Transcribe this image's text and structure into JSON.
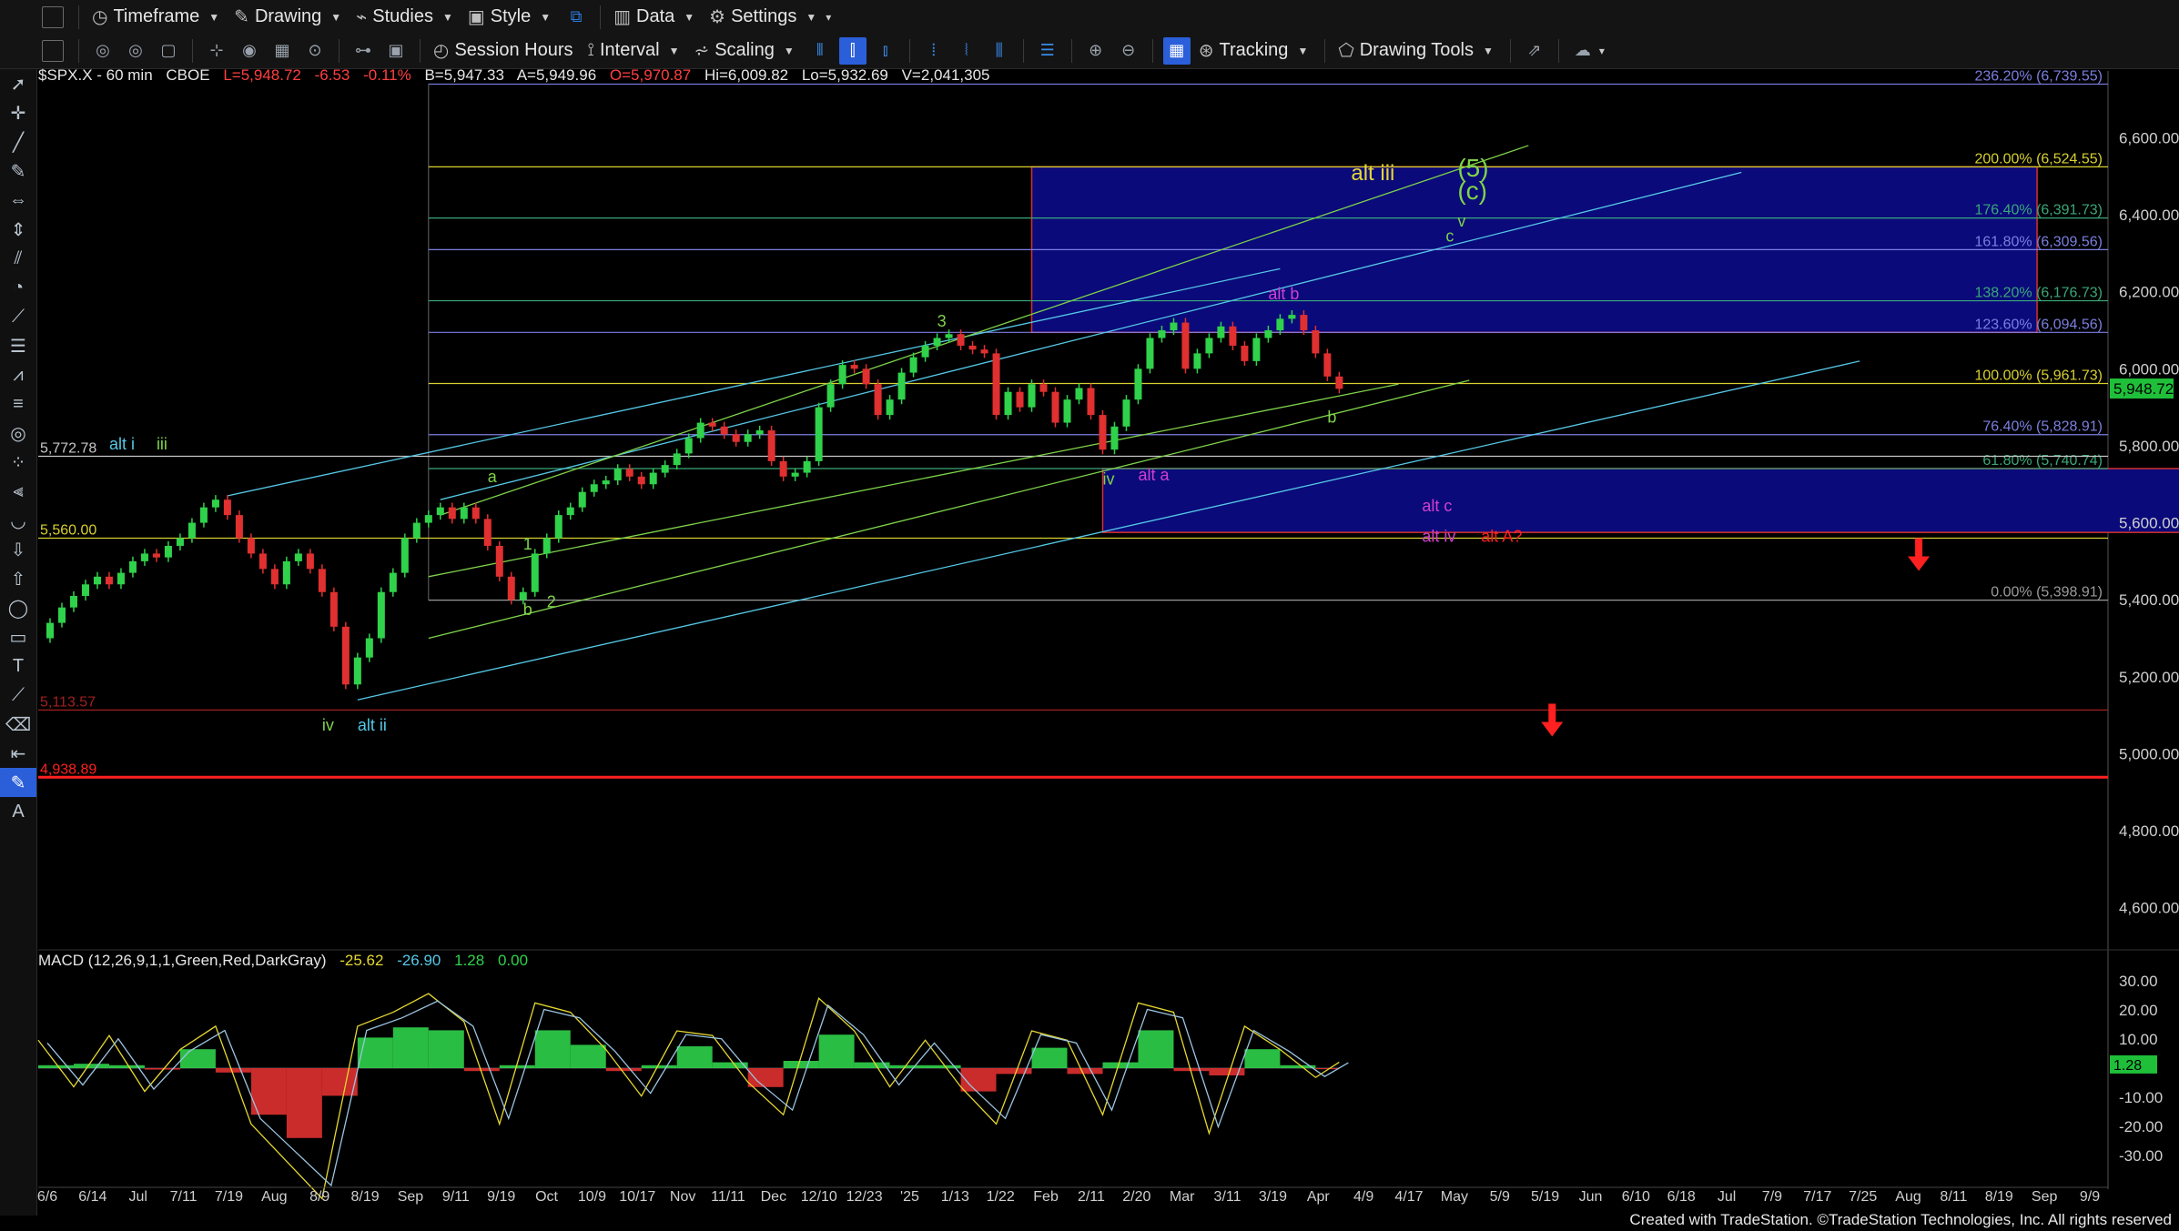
{
  "toolbar": {
    "row1": [
      {
        "label": "Timeframe",
        "icon": "clock-icon"
      },
      {
        "label": "Drawing",
        "icon": "pencil-icon"
      },
      {
        "label": "Studies",
        "icon": "studies-icon"
      },
      {
        "label": "Style",
        "icon": "style-icon"
      },
      {
        "label": "Data",
        "icon": "data-icon"
      },
      {
        "label": "Settings",
        "icon": "gear-icon"
      }
    ],
    "row2": [
      {
        "label": "Session Hours",
        "icon": "session-icon"
      },
      {
        "label": "Interval",
        "icon": "interval-icon"
      },
      {
        "label": "Scaling",
        "icon": "scaling-icon"
      },
      {
        "label": "Tracking",
        "icon": "tracking-icon"
      },
      {
        "label": "Drawing Tools",
        "icon": "drawing-tools-icon"
      }
    ]
  },
  "header": {
    "symbol": "$SPX.X - 60 min",
    "exchange": "CBOE",
    "last": "L=5,948.72",
    "change": "-6.53",
    "pct": "-0.11%",
    "bid": "B=5,947.33",
    "ask": "A=5,949.96",
    "open": "O=5,970.87",
    "high": "Hi=6,009.82",
    "low": "Lo=5,932.69",
    "volume": "V=2,041,305"
  },
  "macd_header": {
    "name": "MACD (12,26,9,1,1,Green,Red,DarkGray)",
    "v1": "-25.62",
    "v2": "-26.90",
    "v3": "1.28",
    "v4": "0.00"
  },
  "footer": "Created with TradeStation. ©TradeStation Technologies, Inc. All rights reserved",
  "colors": {
    "up": "#2fd24a",
    "down": "#e03030",
    "fib": "#8a8fd8",
    "zone": "#0a0a7a",
    "zone_border": "#d43030",
    "cyan": "#55c8e6",
    "green": "#7fd34a",
    "yellow": "#e6d830",
    "magenta": "#d040d0",
    "red": "#ff2020"
  },
  "chart_data": {
    "type": "candlestick",
    "price_axis": {
      "ticks": [
        4600,
        4800,
        5000,
        5200,
        5400,
        5600,
        5800,
        6000,
        6200,
        6400,
        6600
      ],
      "tick_labels": [
        "4,600.00",
        "4,800.00",
        "5,000.00",
        "5,200.00",
        "5,400.00",
        "5,600.00",
        "5,800.00",
        "6,000.00",
        "6,200.00",
        "6,400.00",
        "6,600.00"
      ],
      "ylim": [
        4500,
        6750
      ],
      "last_label": "5,948.72",
      "last": 5948.72
    },
    "time_axis": {
      "labels": [
        "6/6",
        "6/14",
        "Jul",
        "7/11",
        "7/19",
        "Aug",
        "8/9",
        "8/19",
        "Sep",
        "9/11",
        "9/19",
        "Oct",
        "10/9",
        "10/17",
        "Nov",
        "11/11",
        "Dec",
        "12/10",
        "12/23",
        "'25",
        "1/13",
        "1/22",
        "Feb",
        "2/11",
        "2/20",
        "Mar",
        "3/11",
        "3/19",
        "Apr",
        "4/9",
        "4/17",
        "May",
        "5/9",
        "5/19",
        "Jun",
        "6/10",
        "6/18",
        "Jul",
        "7/9",
        "7/17",
        "7/25",
        "Aug",
        "8/11",
        "8/19",
        "Sep",
        "9/9"
      ]
    },
    "price_path": [
      [
        0,
        5300
      ],
      [
        1,
        5340
      ],
      [
        2,
        5380
      ],
      [
        3,
        5410
      ],
      [
        4,
        5440
      ],
      [
        5,
        5460
      ],
      [
        6,
        5440
      ],
      [
        7,
        5470
      ],
      [
        8,
        5500
      ],
      [
        9,
        5520
      ],
      [
        10,
        5510
      ],
      [
        11,
        5540
      ],
      [
        12,
        5560
      ],
      [
        13,
        5600
      ],
      [
        14,
        5640
      ],
      [
        15,
        5660
      ],
      [
        16,
        5620
      ],
      [
        17,
        5560
      ],
      [
        18,
        5520
      ],
      [
        19,
        5480
      ],
      [
        20,
        5440
      ],
      [
        21,
        5500
      ],
      [
        22,
        5520
      ],
      [
        23,
        5480
      ],
      [
        24,
        5420
      ],
      [
        25,
        5330
      ],
      [
        26,
        5180
      ],
      [
        27,
        5250
      ],
      [
        28,
        5300
      ],
      [
        29,
        5420
      ],
      [
        30,
        5470
      ],
      [
        31,
        5560
      ],
      [
        32,
        5600
      ],
      [
        33,
        5620
      ],
      [
        34,
        5640
      ],
      [
        35,
        5610
      ],
      [
        36,
        5640
      ],
      [
        37,
        5610
      ],
      [
        38,
        5540
      ],
      [
        39,
        5460
      ],
      [
        40,
        5400
      ],
      [
        41,
        5420
      ],
      [
        42,
        5520
      ],
      [
        43,
        5560
      ],
      [
        44,
        5620
      ],
      [
        45,
        5640
      ],
      [
        46,
        5680
      ],
      [
        47,
        5700
      ],
      [
        48,
        5710
      ],
      [
        49,
        5740
      ],
      [
        50,
        5720
      ],
      [
        51,
        5700
      ],
      [
        52,
        5730
      ],
      [
        53,
        5750
      ],
      [
        54,
        5780
      ],
      [
        55,
        5820
      ],
      [
        56,
        5860
      ],
      [
        57,
        5850
      ],
      [
        58,
        5830
      ],
      [
        59,
        5810
      ],
      [
        60,
        5830
      ],
      [
        61,
        5840
      ],
      [
        62,
        5760
      ],
      [
        63,
        5720
      ],
      [
        64,
        5730
      ],
      [
        65,
        5760
      ],
      [
        66,
        5900
      ],
      [
        67,
        5960
      ],
      [
        68,
        6010
      ],
      [
        69,
        6000
      ],
      [
        70,
        5960
      ],
      [
        71,
        5880
      ],
      [
        72,
        5920
      ],
      [
        73,
        5990
      ],
      [
        74,
        6030
      ],
      [
        75,
        6060
      ],
      [
        76,
        6080
      ],
      [
        77,
        6090
      ],
      [
        78,
        6060
      ],
      [
        79,
        6050
      ],
      [
        80,
        6040
      ],
      [
        81,
        5880
      ],
      [
        82,
        5940
      ],
      [
        83,
        5900
      ],
      [
        84,
        5960
      ],
      [
        85,
        5940
      ],
      [
        86,
        5860
      ],
      [
        87,
        5920
      ],
      [
        88,
        5950
      ],
      [
        89,
        5880
      ],
      [
        90,
        5790
      ],
      [
        91,
        5850
      ],
      [
        92,
        5920
      ],
      [
        93,
        6000
      ],
      [
        94,
        6080
      ],
      [
        95,
        6100
      ],
      [
        96,
        6120
      ],
      [
        97,
        6000
      ],
      [
        98,
        6040
      ],
      [
        99,
        6080
      ],
      [
        100,
        6110
      ],
      [
        101,
        6060
      ],
      [
        102,
        6020
      ],
      [
        103,
        6080
      ],
      [
        104,
        6100
      ],
      [
        105,
        6130
      ],
      [
        106,
        6140
      ],
      [
        107,
        6100
      ],
      [
        108,
        6040
      ],
      [
        109,
        5980
      ],
      [
        110,
        5948
      ]
    ],
    "fib_levels": [
      {
        "label": "236.20% (6,739.55)",
        "price": 6739.55
      },
      {
        "label": "200.00% (6,524.55)",
        "price": 6524.55
      },
      {
        "label": "176.40% (6,391.73)",
        "price": 6391.73
      },
      {
        "label": "161.80% (6,309.56)",
        "price": 6309.56
      },
      {
        "label": "138.20% (6,176.73)",
        "price": 6176.73
      },
      {
        "label": "123.60% (6,094.56)",
        "price": 6094.56
      },
      {
        "label": "100.00% (5,961.73)",
        "price": 5961.73
      },
      {
        "label": "76.40% (5,828.91)",
        "price": 5828.91
      },
      {
        "label": "61.80% (5,740.74)",
        "price": 5740.74
      },
      {
        "label": "0.00% (5,398.91)",
        "price": 5398.91
      }
    ],
    "horizontal_levels": [
      {
        "label": "5,772.78",
        "price": 5772.78
      },
      {
        "label": "5,560.00",
        "price": 5560.0
      },
      {
        "label": "5,113.57",
        "price": 5113.57
      },
      {
        "label": "4,938.89",
        "price": 4938.89
      }
    ],
    "wave_labels": [
      {
        "text": "alt i",
        "x": 6,
        "price": 5790,
        "color": "cyan"
      },
      {
        "text": "iii",
        "x": 10,
        "price": 5790,
        "color": "green"
      },
      {
        "text": "iv",
        "x": 24,
        "price": 5060,
        "color": "green"
      },
      {
        "text": "alt ii",
        "x": 27,
        "price": 5060,
        "color": "cyan"
      },
      {
        "text": "a",
        "x": 38,
        "price": 5705,
        "color": "green"
      },
      {
        "text": "b",
        "x": 41,
        "price": 5360,
        "color": "green"
      },
      {
        "text": "1",
        "x": 41,
        "price": 5530,
        "color": "green"
      },
      {
        "text": "2",
        "x": 43,
        "price": 5380,
        "color": "green"
      },
      {
        "text": "3",
        "x": 76,
        "price": 6110,
        "color": "green"
      },
      {
        "text": "iv",
        "x": 90,
        "price": 5700,
        "color": "green"
      },
      {
        "text": "alt a",
        "x": 93,
        "price": 5710,
        "color": "magenta"
      },
      {
        "text": "alt b",
        "x": 104,
        "price": 6180,
        "color": "magenta"
      },
      {
        "text": "b",
        "x": 109,
        "price": 5860,
        "color": "green"
      },
      {
        "text": "alt c",
        "x": 117,
        "price": 5630,
        "color": "magenta"
      },
      {
        "text": "alt iv",
        "x": 117,
        "price": 5550,
        "color": "magenta"
      },
      {
        "text": "alt A?",
        "x": 122,
        "price": 5550,
        "color": "red"
      },
      {
        "text": "alt iii",
        "x": 111,
        "price": 6490,
        "color": "yellow"
      },
      {
        "text": "(5)",
        "x": 120,
        "price": 6500,
        "color": "green"
      },
      {
        "text": "(c)",
        "x": 120,
        "price": 6440,
        "color": "green"
      },
      {
        "text": "v",
        "x": 120,
        "price": 6370,
        "color": "green"
      },
      {
        "text": "c",
        "x": 119,
        "price": 6330,
        "color": "green"
      }
    ],
    "macd_axis": {
      "ticks": [
        30,
        20,
        10,
        0,
        -10,
        -20,
        -30
      ],
      "tick_labels": [
        "30.00",
        "20.00",
        "10.00",
        "",
        "-10.00",
        "-20.00",
        "-30.00"
      ],
      "ylim": [
        -40,
        35
      ],
      "last_label": "1.28"
    },
    "macd_hist": [
      [
        0,
        6
      ],
      [
        3,
        -4
      ],
      [
        6,
        7
      ],
      [
        9,
        -5
      ],
      [
        12,
        4
      ],
      [
        15,
        9
      ],
      [
        18,
        -12
      ],
      [
        21,
        -20
      ],
      [
        24,
        -28
      ],
      [
        27,
        9
      ],
      [
        30,
        12
      ],
      [
        33,
        16
      ],
      [
        36,
        10
      ],
      [
        39,
        -12
      ],
      [
        42,
        14
      ],
      [
        45,
        12
      ],
      [
        48,
        4
      ],
      [
        51,
        -6
      ],
      [
        54,
        8
      ],
      [
        57,
        7
      ],
      [
        60,
        -3
      ],
      [
        63,
        -10
      ],
      [
        66,
        15
      ],
      [
        69,
        8
      ],
      [
        72,
        -4
      ],
      [
        75,
        6
      ],
      [
        78,
        -4
      ],
      [
        81,
        -12
      ],
      [
        84,
        8
      ],
      [
        87,
        6
      ],
      [
        90,
        -10
      ],
      [
        93,
        14
      ],
      [
        96,
        12
      ],
      [
        99,
        -14
      ],
      [
        102,
        9
      ],
      [
        105,
        4
      ],
      [
        108,
        -2
      ],
      [
        110,
        1.28
      ]
    ]
  }
}
